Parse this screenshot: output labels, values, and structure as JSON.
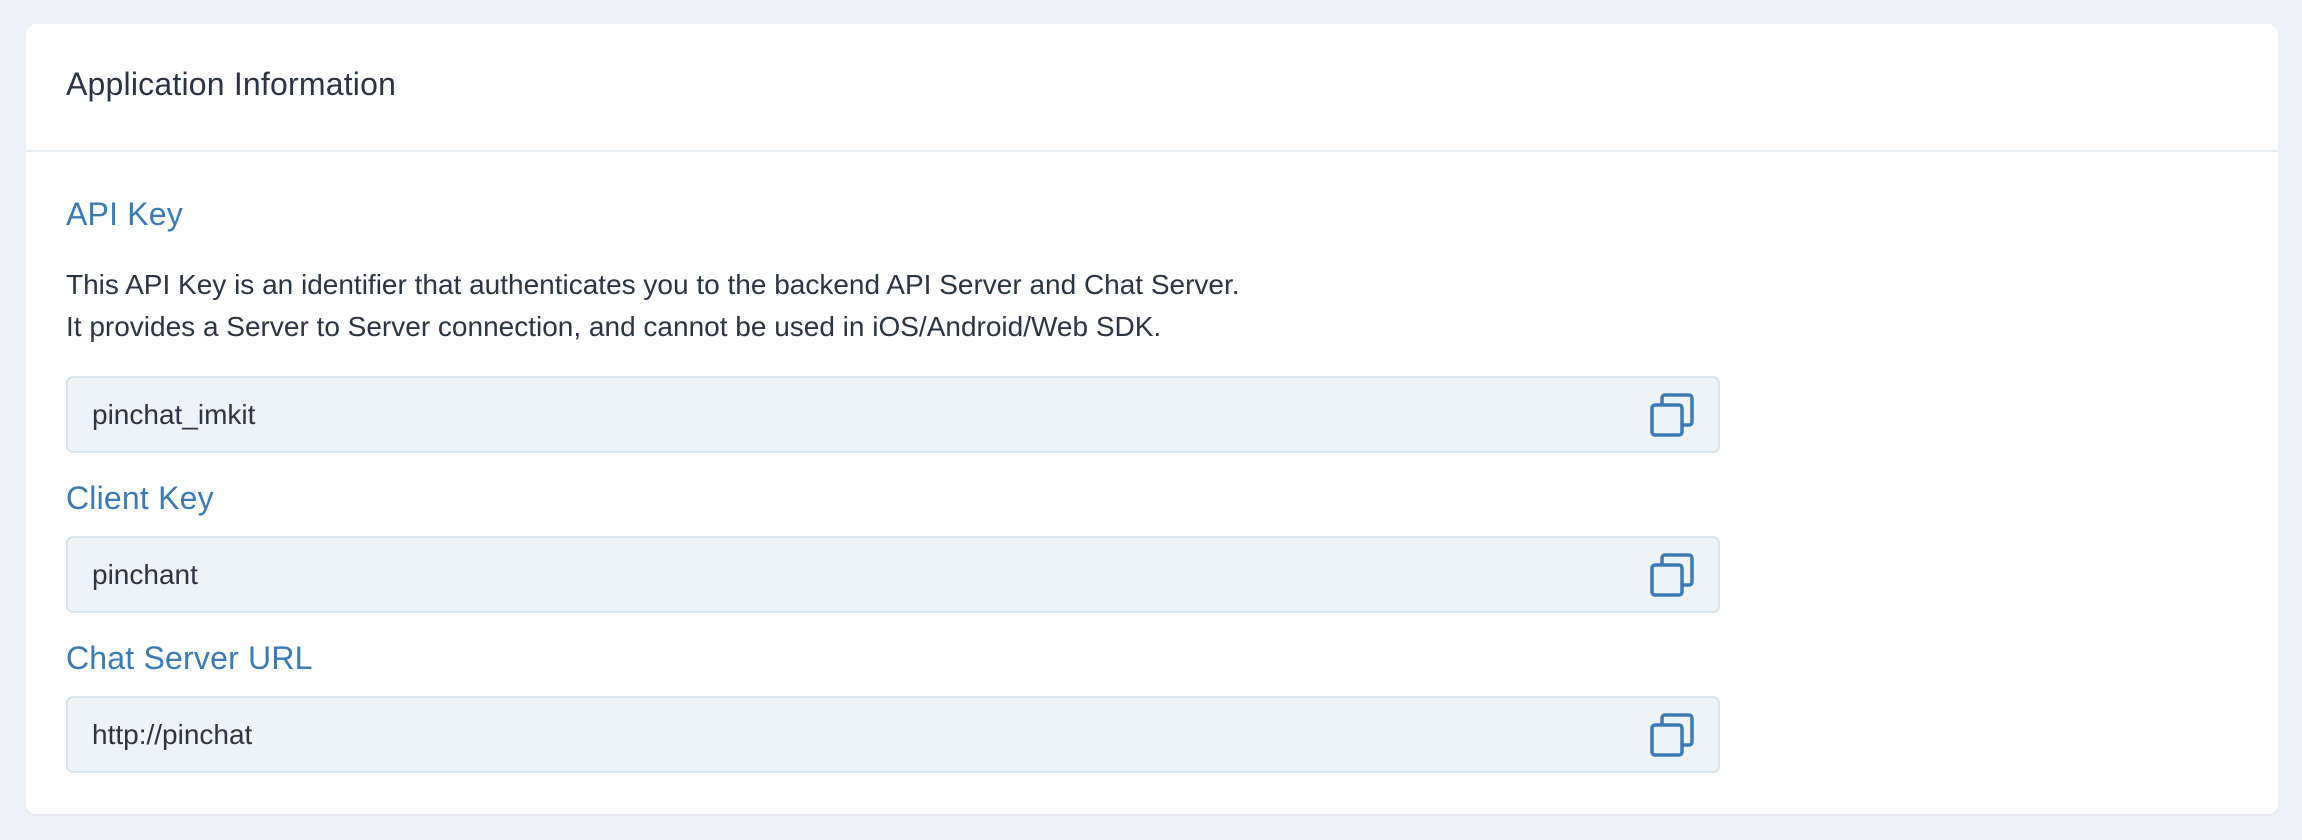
{
  "card": {
    "title": "Application Information"
  },
  "api_key": {
    "label": "API Key",
    "description_line1": "This API Key is an identifier that authenticates you to the backend API Server and Chat Server.",
    "description_line2": "It provides a Server to Server connection, and cannot be used in iOS/Android/Web SDK.",
    "value": "pinchat_imkit",
    "copy_icon": "copy-icon"
  },
  "client_key": {
    "label": "Client Key",
    "value": "pinchant",
    "copy_icon": "copy-icon"
  },
  "chat_server_url": {
    "label": "Chat Server URL",
    "value": "http://pinchat",
    "copy_icon": "copy-icon"
  },
  "colors": {
    "page_background": "#eef2f6",
    "card_background": "#ffffff",
    "section_label": "#3b7ab3",
    "field_background": "#eef3f8",
    "icon": "#3b7ab3"
  }
}
